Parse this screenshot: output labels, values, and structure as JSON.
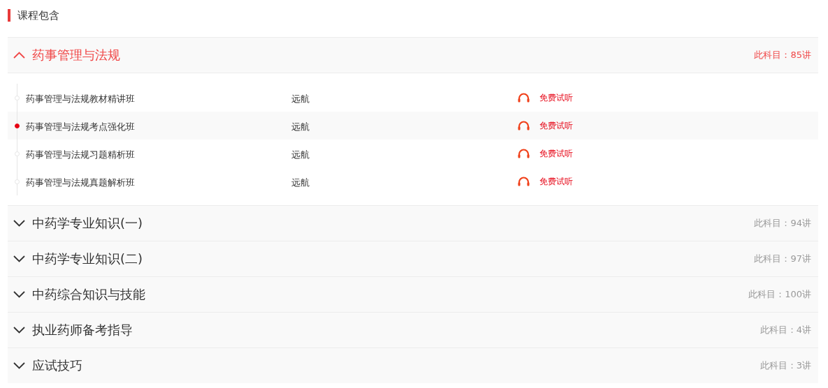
{
  "heading": "课程包含",
  "sections": [
    {
      "title": "药事管理与法规",
      "count": "此科目：85讲",
      "expanded": true,
      "lessons": [
        {
          "name": "药事管理与法规教材精讲班",
          "teacher": "远航",
          "action": "免费试听",
          "selected": false
        },
        {
          "name": "药事管理与法规考点强化班",
          "teacher": "远航",
          "action": "免费试听",
          "selected": true
        },
        {
          "name": "药事管理与法规习题精析班",
          "teacher": "远航",
          "action": "免费试听",
          "selected": false
        },
        {
          "name": "药事管理与法规真题解析班",
          "teacher": "远航",
          "action": "免费试听",
          "selected": false
        }
      ]
    },
    {
      "title": "中药学专业知识(一)",
      "count": "此科目：94讲",
      "expanded": false
    },
    {
      "title": "中药学专业知识(二)",
      "count": "此科目：97讲",
      "expanded": false
    },
    {
      "title": "中药综合知识与技能",
      "count": "此科目：100讲",
      "expanded": false
    },
    {
      "title": "执业药师备考指导",
      "count": "此科目：4讲",
      "expanded": false
    },
    {
      "title": "应试技巧",
      "count": "此科目：3讲",
      "expanded": false
    }
  ]
}
